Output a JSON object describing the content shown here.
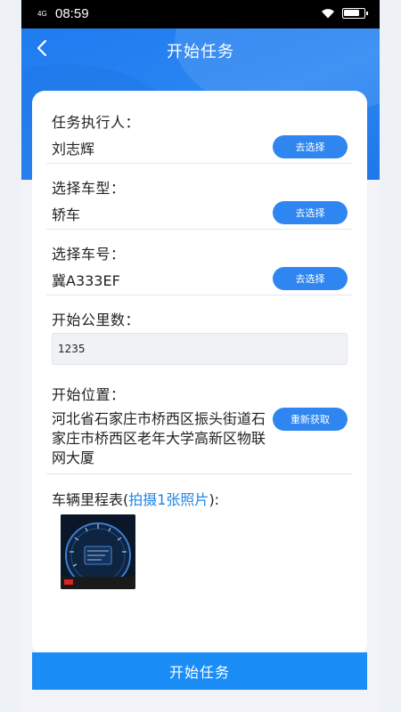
{
  "status_bar": {
    "network": "4G",
    "time": "08:59",
    "battery_level": 0.8
  },
  "header": {
    "title": "开始任务"
  },
  "form": {
    "executor": {
      "label": "任务执行人：",
      "value": "刘志辉",
      "button": "去选择"
    },
    "vehicle_type": {
      "label": "选择车型：",
      "value": "轿车",
      "button": "去选择"
    },
    "vehicle_number": {
      "label": "选择车号：",
      "value": "冀A333EF",
      "button": "去选择"
    },
    "start_mileage": {
      "label": "开始公里数：",
      "value": "1235"
    },
    "start_location": {
      "label": "开始位置：",
      "value": "河北省石家庄市桥西区振头街道石家庄市桥西区老年大学高新区物联网大厦",
      "button": "重新获取"
    },
    "odometer": {
      "label_prefix": "车辆里程表(",
      "label_link": "拍摄1张照片",
      "label_suffix": "):"
    }
  },
  "footer": {
    "start_button": "开始任务"
  },
  "colors": {
    "primary": "#2f86f0",
    "header_blue": "#1f7cf0",
    "link": "#1f86e8"
  }
}
